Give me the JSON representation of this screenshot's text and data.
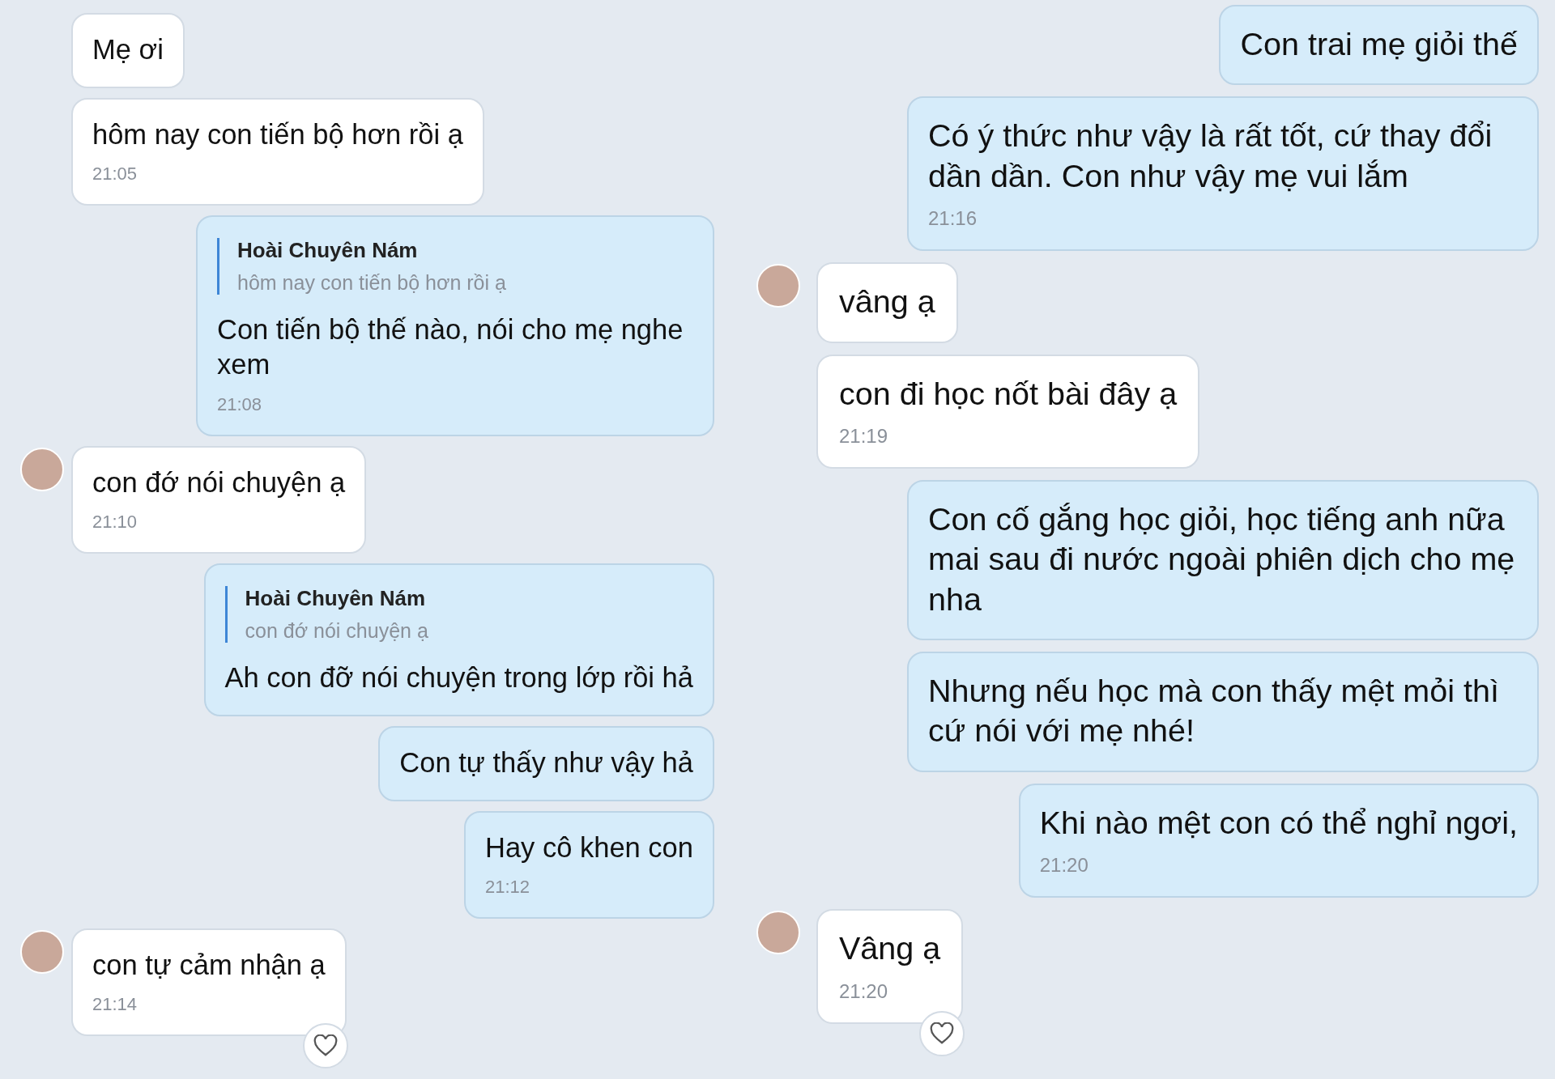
{
  "columns": [
    {
      "messages": [
        {
          "kind": "incoming",
          "avatar": false,
          "text": "Mẹ ơi"
        },
        {
          "kind": "incoming",
          "avatar": false,
          "text": "hôm nay con tiến bộ hơn rồi ạ",
          "time": "21:05"
        },
        {
          "kind": "outgoing",
          "reply": {
            "name": "Hoài Chuyên Nám",
            "text": "hôm nay con tiến bộ hơn rồi ạ"
          },
          "text": "Con tiến bộ thế nào, nói cho mẹ nghe xem",
          "time": "21:08"
        },
        {
          "kind": "incoming",
          "avatar": true,
          "text": "con đớ nói chuyện ạ",
          "time": "21:10"
        },
        {
          "kind": "outgoing",
          "reply": {
            "name": "Hoài Chuyên Nám",
            "text": "con đớ nói chuyện ạ"
          },
          "text": "Ah con đỡ nói chuyện trong lớp rồi hả"
        },
        {
          "kind": "outgoing",
          "text": "Con tự thấy như vậy hả"
        },
        {
          "kind": "outgoing",
          "text": "Hay cô khen con",
          "time": "21:12"
        },
        {
          "kind": "incoming",
          "avatar": true,
          "text": "con tự cảm nhận ạ",
          "time": "21:14",
          "heart": true
        }
      ]
    },
    {
      "messages": [
        {
          "kind": "outgoing",
          "text": "Con trai mẹ giỏi thế"
        },
        {
          "kind": "outgoing",
          "text": "Có ý thức như vậy là rất tốt, cứ thay đổi dần dần. Con như vậy mẹ vui lắm",
          "time": "21:16"
        },
        {
          "kind": "incoming",
          "avatar": true,
          "text": "vâng ạ"
        },
        {
          "kind": "incoming",
          "avatar": false,
          "text": "con đi học nốt bài đây ạ",
          "time": "21:19"
        },
        {
          "kind": "outgoing",
          "text": "Con cố gắng học giỏi, học tiếng anh nữa mai sau đi nước ngoài phiên dịch cho mẹ nha"
        },
        {
          "kind": "outgoing",
          "text": "Nhưng nếu học mà con thấy mệt mỏi thì cứ nói với mẹ nhé!"
        },
        {
          "kind": "outgoing",
          "text": "Khi nào mệt con có thể nghỉ ngơi,",
          "time": "21:20"
        },
        {
          "kind": "incoming",
          "avatar": true,
          "text": "Vâng ạ",
          "time": "21:20",
          "heart": true
        }
      ]
    }
  ]
}
